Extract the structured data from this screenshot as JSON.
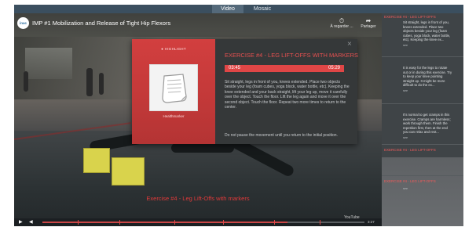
{
  "tabs": [
    {
      "label": "Video",
      "active": true
    },
    {
      "label": "Mosaic",
      "active": false
    }
  ],
  "video": {
    "logo_text": "inac",
    "title": "IMP #1 Mobilization and Release of Tight Hip Flexors",
    "actions": [
      {
        "icon": "clock-icon",
        "glyph": "⏱",
        "label": "À regarder ..."
      },
      {
        "icon": "share-icon",
        "glyph": "➦",
        "label": "Partager"
      }
    ],
    "caption": "Exercise #4 - Leg Lift-Offs with markers",
    "watermark": "YouTube",
    "controls": {
      "play_glyph": "▶",
      "volume_glyph": "◀",
      "time": "3:27",
      "progress": 0.76,
      "markers": [
        0.11,
        0.24,
        0.41,
        0.56,
        0.72,
        0.86
      ]
    }
  },
  "modal": {
    "highlight_label": "● HIGHLIGHT",
    "thumb_caption": "Healthmarker",
    "title": "EXERCISE #4 - LEG LIFT-OFFS WITH MARKERS",
    "time_start": "03:45",
    "time_end": "05:29",
    "description": "Sit straight, legs in front of you, knees extended. Place two objects beside your leg (foam cubes, yoga block, water bottle, etc). Keeping the knee extended and your back straight, lift your leg up, move it carefully over the object. Touch the floor. Lift the leg again and move it over the second object. Touch the floor. Repeat two more times to return to the center.",
    "description2": "Do not pause the movement until you return to the initial position.",
    "close_glyph": "×"
  },
  "panel": {
    "cards": [
      {
        "title": "EXERCISE #4 - LEG LIFT-OFFS",
        "body": [
          "Sit straight, legs in front of you,",
          "knees extended. Place two",
          "objects beside your leg (foam",
          "cubes, yoga block, water bottle,",
          "etc). Keeping the knee ex..."
        ],
        "more": "see"
      },
      {
        "title": "",
        "body": [
          "It is easy for the legs to rotate",
          "out or in during this exercise. Try",
          "to keep your knee pointing",
          "straight up. It might be more",
          "difficult to do the ex..."
        ],
        "more": "see"
      },
      {
        "title": "",
        "body": [
          "It's normal to get cramps in this",
          "exercise. Cramps are harmless;",
          "work through them. Finish the",
          "repetition first, then at the end",
          "you can relax and rest..."
        ],
        "more": "see"
      },
      {
        "title": "EXERCISE #4 - LEG LIFT-OFFS",
        "body": [],
        "more": ""
      },
      {
        "title": "EXERCISE #4 - LEG LIFT-OFFS",
        "body": [],
        "more": "see"
      }
    ]
  }
}
